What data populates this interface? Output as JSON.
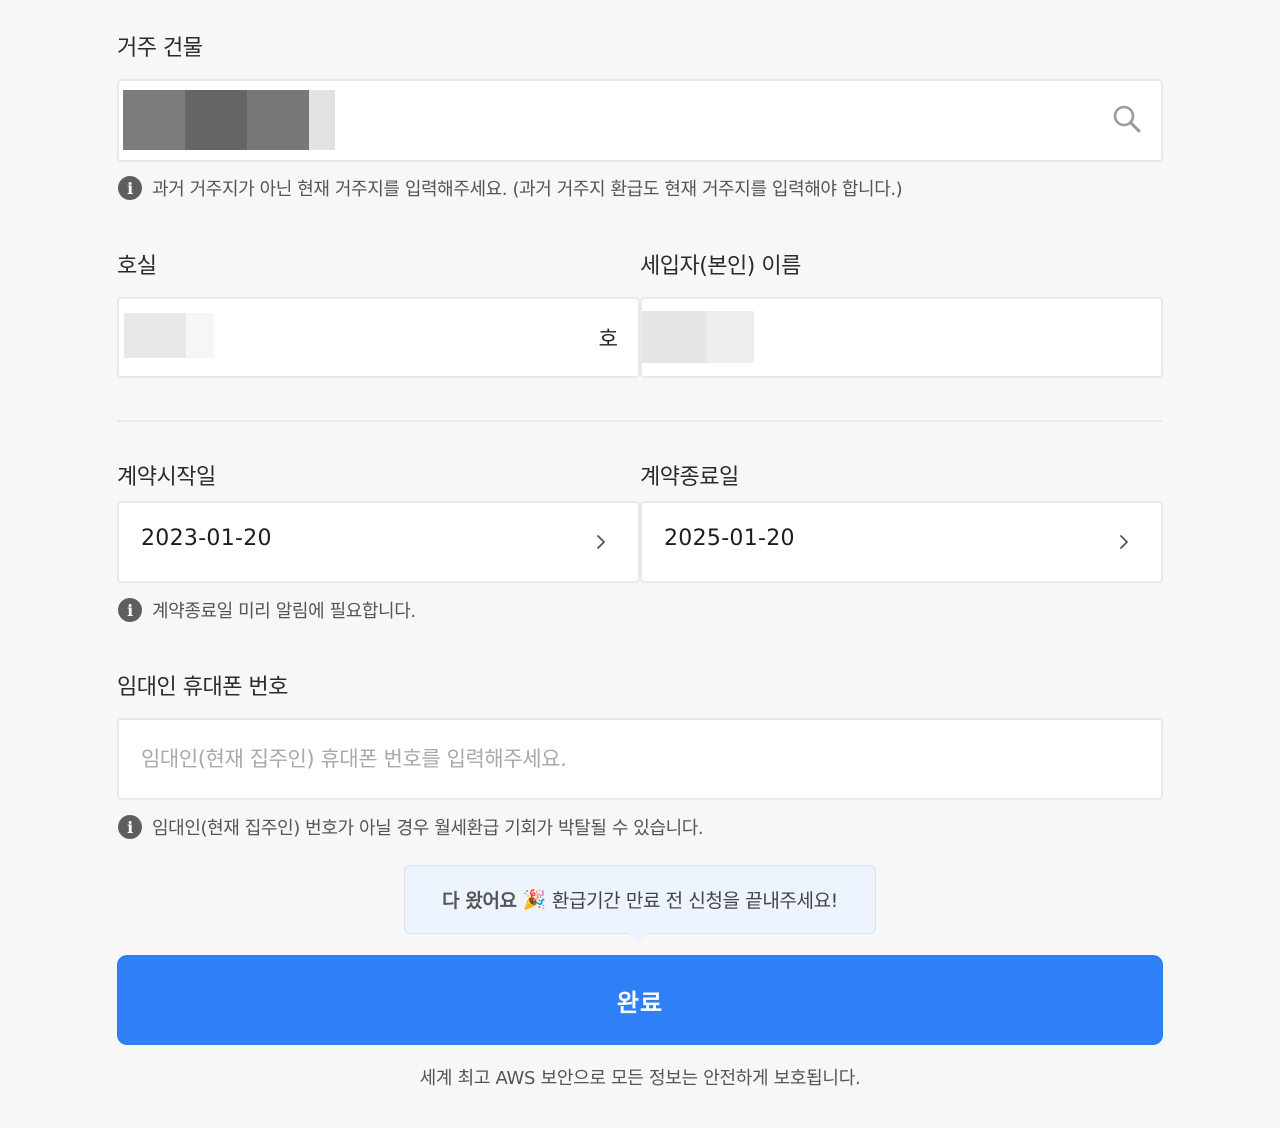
{
  "building": {
    "label": "거주 건물",
    "hint": "과거 거주지가 아닌 현재 거주지를 입력해주세요. (과거 거주지 환급도 현재 거주지를 입력해야 합니다.)",
    "icon": "search-icon"
  },
  "unit": {
    "label": "호실",
    "suffix": "호"
  },
  "tenant": {
    "label": "세입자(본인) 이름"
  },
  "contract": {
    "start_label": "계약시작일",
    "start_value": "2023-01-20",
    "end_label": "계약종료일",
    "end_value": "2025-01-20",
    "hint": "계약종료일 미리 알림에 필요합니다."
  },
  "landlord": {
    "label": "임대인 휴대폰 번호",
    "placeholder": "임대인(현재 집주인) 휴대폰 번호를 입력해주세요.",
    "hint": "임대인(현재 집주인) 번호가 아닐 경우 월세환급 기회가 박탈될 수 있습니다."
  },
  "tooltip": {
    "bold": "다 왔어요",
    "emoji": "🎉",
    "text": "환급기간 만료 전 신청을 끝내주세요!"
  },
  "submit_label": "완료",
  "footer": "세계 최고 AWS 보안으로 모든 정보는 안전하게 보호됩니다.",
  "colors": {
    "accent": "#2f80f7",
    "background": "#f7f7f7",
    "tooltip_bg": "#eef4fd"
  }
}
